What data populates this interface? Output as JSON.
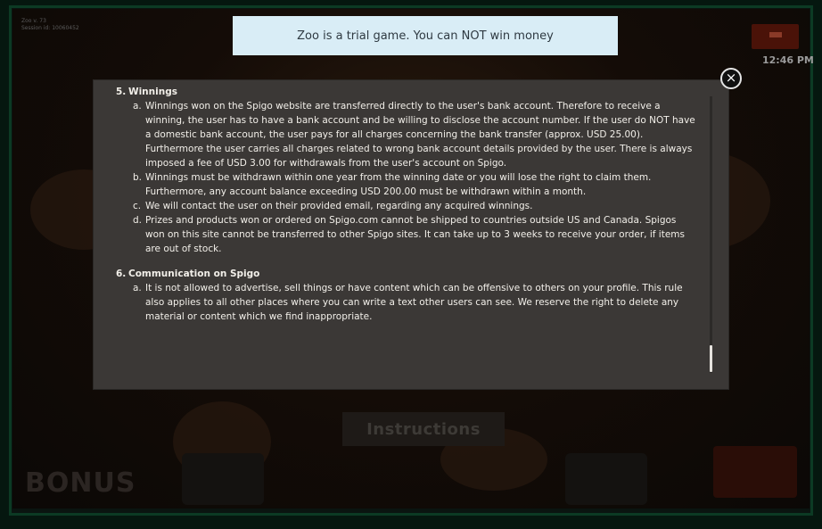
{
  "banner": {
    "text": "Zoo is a trial game. You can NOT win money"
  },
  "header": {
    "balance_line": "Zoo v. 73",
    "session_line": "Session id: 10060452",
    "clock": "12:46 PM"
  },
  "game": {
    "instructions_label": "Instructions",
    "bonus_label": "BONUS"
  },
  "modal": {
    "sections": [
      {
        "number": "5.",
        "title": "Winnings",
        "items": [
          {
            "letter": "a.",
            "text": "Winnings won on the Spigo website are transferred directly to the user's bank account. Therefore to receive a winning, the user has to have a bank account and be willing to disclose the account number. If the user do NOT have a domestic bank account, the user pays for all charges concerning the bank transfer (approx. USD 25.00). Furthermore the user carries all charges related to wrong bank account details provided by the user. There is always imposed a fee of USD 3.00 for withdrawals from the user's account on Spigo."
          },
          {
            "letter": "b.",
            "text": "Winnings must be withdrawn within one year from the winning date or you will lose the right to claim them. Furthermore, any account balance exceeding USD 200.00 must be withdrawn within a month."
          },
          {
            "letter": "c.",
            "text": "We will contact the user on their provided email, regarding any acquired winnings."
          },
          {
            "letter": "d.",
            "text": "Prizes and products won or ordered on Spigo.com cannot be shipped to countries outside US and Canada. Spigos won on this site cannot be transferred to other Spigo sites. It can take up to 3 weeks to receive your order, if items are out of stock."
          }
        ]
      },
      {
        "number": "6.",
        "title": "Communication on Spigo",
        "items": [
          {
            "letter": "a.",
            "text": "It is not allowed to advertise, sell things or have content which can be offensive to others on your profile. This rule also applies to all other places where you can write a text other users can see. We reserve the right to delete any material or content which we find inappropriate."
          }
        ]
      }
    ],
    "close_symbol": "×"
  },
  "icons": {
    "close": "close-icon",
    "menu": "hamburger-menu-icon"
  }
}
